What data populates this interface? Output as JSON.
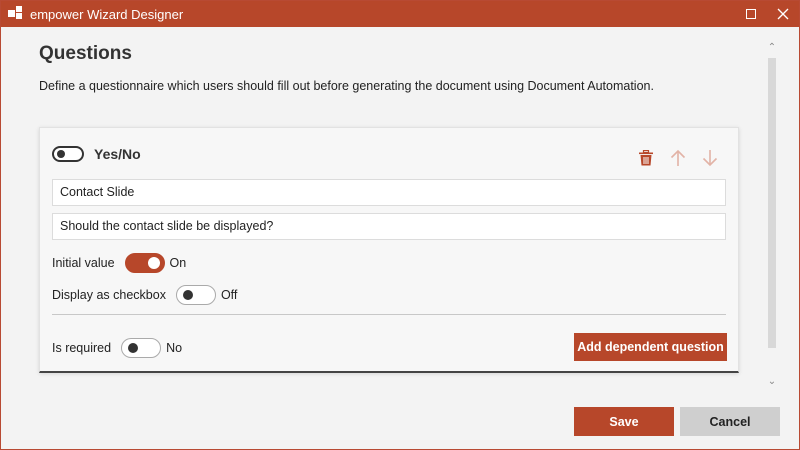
{
  "window": {
    "title": "empower Wizard Designer",
    "icon": "app-logo-icon",
    "controls": [
      "maximize-icon",
      "close-icon"
    ]
  },
  "page": {
    "title": "Questions",
    "description": "Define a questionnaire which users should fill out before generating the document using Document Automation."
  },
  "question": {
    "type_label": "Yes/No",
    "title_value": "Contact Slide",
    "question_value": "Should the contact slide be displayed?",
    "initial_value": {
      "label": "Initial value",
      "state": "On",
      "on": true
    },
    "display_checkbox": {
      "label": "Display as checkbox",
      "state": "Off",
      "on": false
    },
    "is_required": {
      "label": "Is required",
      "state": "No",
      "on": false
    },
    "add_dependent_label": "Add dependent question",
    "actions": [
      "delete-icon",
      "move-up-icon",
      "move-down-icon"
    ]
  },
  "footer": {
    "save_label": "Save",
    "cancel_label": "Cancel"
  },
  "colors": {
    "accent": "#b7472a",
    "accent_muted": "#e2b3a6",
    "cancel_bg": "#cfcfcf",
    "background": "#f3f3f3"
  }
}
